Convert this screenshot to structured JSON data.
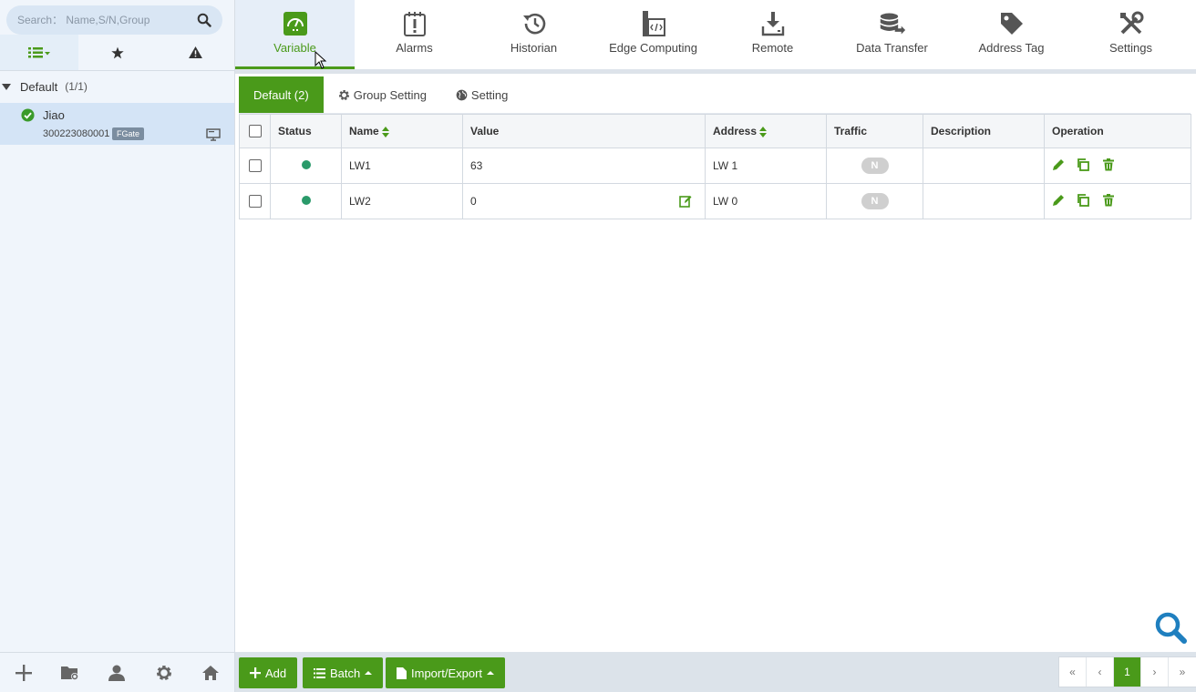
{
  "search": {
    "placeholder": "Search： Name,S/N,Group"
  },
  "sidebar": {
    "group_label": "Default",
    "group_count": "(1/1)",
    "device": {
      "name": "Jiao",
      "serial": "300223080001",
      "badge": "FGate"
    }
  },
  "nav": [
    {
      "label": "Variable",
      "icon": "gauge-icon"
    },
    {
      "label": "Alarms",
      "icon": "alarm-icon"
    },
    {
      "label": "Historian",
      "icon": "history-icon"
    },
    {
      "label": "Edge Computing",
      "icon": "code-icon"
    },
    {
      "label": "Remote",
      "icon": "download-icon"
    },
    {
      "label": "Data Transfer",
      "icon": "database-icon"
    },
    {
      "label": "Address Tag",
      "icon": "tag-icon"
    },
    {
      "label": "Settings",
      "icon": "tools-icon"
    }
  ],
  "subtabs": {
    "default": "Default (2)",
    "group_setting": "Group Setting",
    "setting": "Setting"
  },
  "table": {
    "headers": {
      "status": "Status",
      "name": "Name",
      "value": "Value",
      "address": "Address",
      "traffic": "Traffic",
      "description": "Description",
      "operation": "Operation"
    },
    "rows": [
      {
        "name": "LW1",
        "value": "63",
        "address": "LW 1",
        "traffic": "N",
        "description": ""
      },
      {
        "name": "LW2",
        "value": "0",
        "address": "LW 0",
        "traffic": "N",
        "description": ""
      }
    ]
  },
  "buttons": {
    "add": "Add",
    "batch": "Batch",
    "import_export": "Import/Export"
  },
  "pager": {
    "first": "«",
    "prev": "‹",
    "current": "1",
    "next": "›",
    "last": "»"
  },
  "colors": {
    "accent": "#4a9a1a",
    "status_online": "#2a9a6a"
  }
}
